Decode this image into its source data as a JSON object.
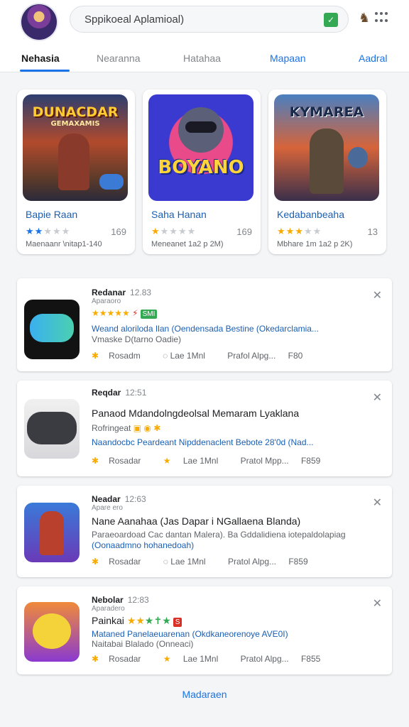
{
  "header": {
    "search_text": "Sppikoeal Aplamioal)",
    "mic_glyph": "✓"
  },
  "tabs": [
    {
      "label": "Nehasia",
      "active": true
    },
    {
      "label": "Nearanna"
    },
    {
      "label": "Hatahaa"
    },
    {
      "label": "Mapaan"
    },
    {
      "label": "Aadral"
    }
  ],
  "featured": [
    {
      "art_title": "DUNACDAR",
      "art_subtitle": "GEMAXAMIS",
      "name": "Bapie Raan",
      "stars": "★★★★★",
      "count": "169",
      "meta": "Maenaanr  \\nitap1-140"
    },
    {
      "art_title": "BOYANO",
      "art_subtitle": "",
      "name": "Saha Hanan",
      "stars": "★★★★★",
      "count": "169",
      "meta": "Meneanet  1a2 p 2M)"
    },
    {
      "art_title": "KYMAREA",
      "art_subtitle": "",
      "name": "Kedabanbeaha",
      "stars": "★★★★★",
      "count": "13",
      "meta": "Mbhare 1m  1a2 p 2K)"
    }
  ],
  "list": [
    {
      "title": "Redanar",
      "time": "12.83",
      "sub": "Aparaoro",
      "line1": "★★★★★ ⚡ SMI",
      "line2": "Weand aloriloda Ilan (Oendensada Bestine (Okedarclamia...",
      "line3": "Vmaske D(tarno Oadie)",
      "footer": [
        "Rosadm",
        "Lae 1Mnl",
        "Prafol Alpg... ",
        "F80"
      ]
    },
    {
      "title": "Reqdar",
      "time": "12:51",
      "sub": "",
      "line1": "Panaod Mdandolngdeolsal Memaram Lyaklana",
      "line2": "Rofringeat",
      "line3": "Naandocbc Peardeant Nipddenaclent Bebote 28'0d (Nad...",
      "footer": [
        "Rosadar",
        "Lae 1Mnl",
        "Pratol Mpp... ",
        "F859"
      ]
    },
    {
      "title": "Neadar",
      "time": "12:63",
      "sub": "Apare ero",
      "line1": "Nane Aanahaa (Jas Dapar i NGallaena Blanda)",
      "line2": "Paraeoardoad Cac dantan Malera). Ba Gddalidiena iotepaldolapiag",
      "line3": "(Oonaadmno hohanedoah)",
      "footer": [
        "Rosadar",
        "Lae 1Mnl",
        "Pratol Alpg... ",
        "F859"
      ]
    },
    {
      "title": "Nebolar",
      "time": "12:83",
      "sub": "Aparadero",
      "line1": "Painkai",
      "line2": "Mataned Panelaeuarenan (Okdkaneorenoye AVE0I)",
      "line3": "Naitabai Blalado (Onneaci)",
      "footer": [
        "Rosadar",
        "Lae 1Mnl",
        "Pratol Alpg... ",
        "F855"
      ]
    }
  ],
  "footer_link": "Madaraen",
  "colors": {
    "accent": "#1a73e8",
    "star": "#f9ab00",
    "green": "#34a853"
  }
}
